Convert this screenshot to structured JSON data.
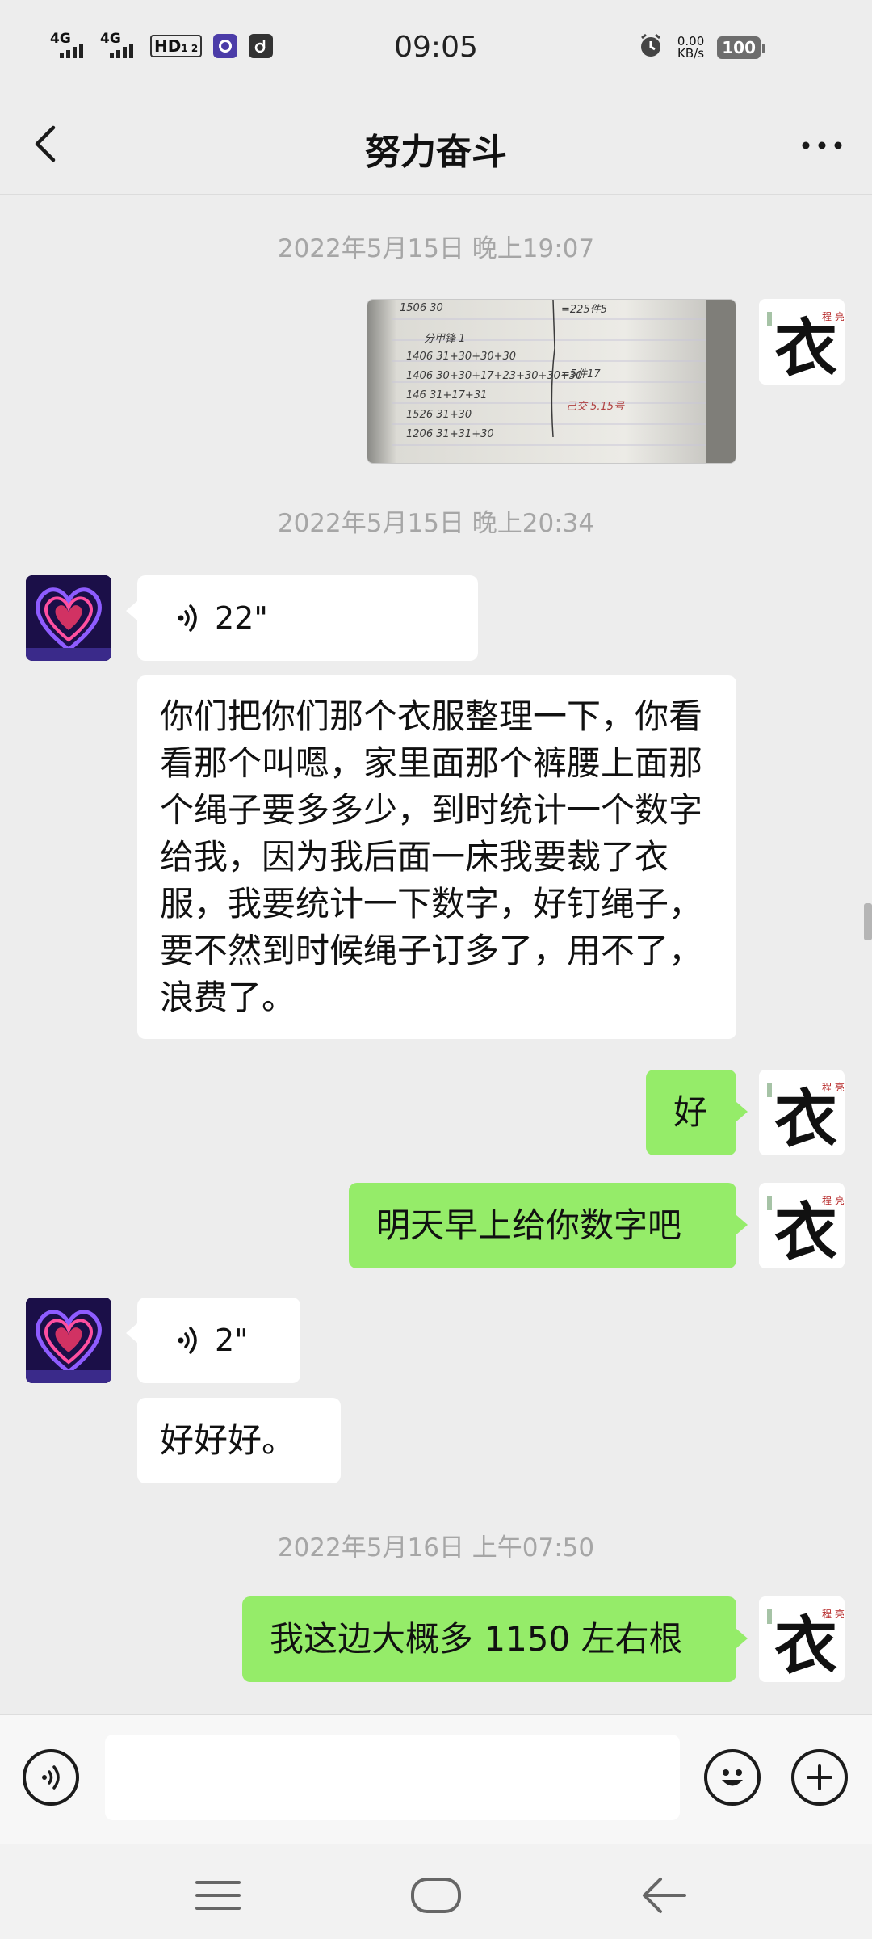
{
  "status_bar": {
    "signal_1": "4G",
    "signal_2": "4G",
    "hd_badge": "HD",
    "hd_sub": "1 2",
    "time": "09:05",
    "net_speed_value": "0.00",
    "net_speed_unit": "KB/s",
    "battery": "100"
  },
  "header": {
    "title": "努力奋斗",
    "back_icon": "chevron-left-icon",
    "more_icon": "more-dots-icon"
  },
  "messages": {
    "ts1": "2022年5月15日 晚上19:07",
    "photo_lines": [
      "1506 30",
      "分甲锋 1",
      "1406 31+30+30+30",
      "1406 30+30+17+23+30+30+30",
      "146 31+17+31",
      "1526 31+30",
      "1206 31+31+30",
      "=225件5",
      "=5件17",
      "己交 5.15号"
    ],
    "ts2": "2022年5月15日 晚上20:34",
    "voice1_duration": "22\"",
    "long_text": "你们把你们那个衣服整理一下，你看看那个叫嗯，家里面那个裤腰上面那个绳子要多多少，到时统计一个数字给我，因为我后面一床我要裁了衣服，我要统计一下数字，好钉绳子，要不然到时候绳子订多了，用不了，浪费了。",
    "reply1": "好",
    "reply2": "明天早上给你数字吧",
    "voice2_duration": "2\"",
    "short_text": "好好好。",
    "ts3": "2022年5月16日 上午07:50",
    "reply3": "我这边大概多 1150 左右根",
    "my_avatar_char": "衣",
    "my_avatar_small": "程 亮"
  },
  "input_bar": {
    "voice_icon": "voice-icon",
    "emoji_icon": "emoji-icon",
    "plus_icon": "plus-icon",
    "placeholder": ""
  },
  "nav_bar": {
    "menu_icon": "menu-icon",
    "home_icon": "home-icon",
    "back_icon": "back-arrow-icon"
  }
}
